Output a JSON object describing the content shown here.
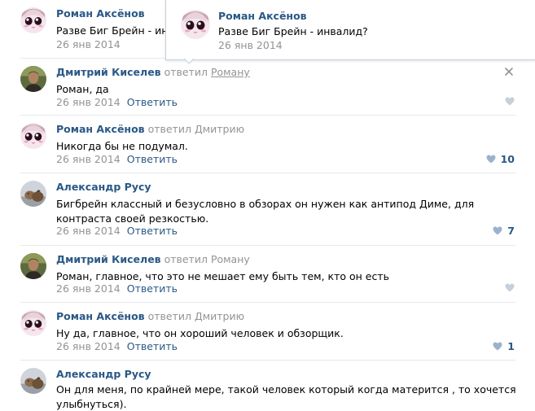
{
  "colors": {
    "author": "#2a5885",
    "muted": "#939393",
    "divider": "#e7e8ec",
    "heart_inactive": "#c5d0db",
    "heart_active": "#9bb2cc"
  },
  "comments": [
    {
      "author": "Роман Аксёнов",
      "reply_word": "",
      "reply_target": "",
      "text": "Разве Биг Брейн - инвалид?",
      "text_visible": "Разве Биг Брейн - инв",
      "date": "26 янв 2014",
      "reply_label": "Ответить",
      "likes": "",
      "avatar": "anime-avatar"
    },
    {
      "author": "Дмитрий Киселев",
      "reply_word": "ответил",
      "reply_target": "Роману",
      "text": "Роман, да",
      "date": "26 янв 2014",
      "reply_label": "Ответить",
      "likes": "",
      "avatar": "photo-avatar-man"
    },
    {
      "author": "Роман Аксёнов",
      "reply_word": "ответил",
      "reply_target": "Дмитрию",
      "text": "Никогда бы не подумал.",
      "date": "26 янв 2014",
      "reply_label": "Ответить",
      "likes": "10",
      "avatar": "anime-avatar"
    },
    {
      "author": "Александр Русу",
      "reply_word": "",
      "reply_target": "",
      "text": "Бигбрейн классный и безусловно в обзорах он нужен как антипод Диме, для контраста своей резкостью.",
      "date": "26 янв 2014",
      "reply_label": "Ответить",
      "likes": "7",
      "avatar": "photo-avatar-dog"
    },
    {
      "author": "Дмитрий Киселев",
      "reply_word": "ответил",
      "reply_target": "Роману",
      "text": "Роман, главное, что это не мешает ему быть тем, кто он есть",
      "date": "26 янв 2014",
      "reply_label": "Ответить",
      "likes": "",
      "avatar": "photo-avatar-man"
    },
    {
      "author": "Роман Аксёнов",
      "reply_word": "ответил",
      "reply_target": "Дмитрию",
      "text": "Ну да, главное, что он хороший человек и обзорщик.",
      "date": "26 янв 2014",
      "reply_label": "Ответить",
      "likes": "1",
      "avatar": "anime-avatar"
    },
    {
      "author": "Александр Русу",
      "reply_word": "",
      "reply_target": "",
      "text": "Он для меня, по крайней мере, такой человек который когда матерится , то хочется улыбнуться).",
      "date": "",
      "reply_label": "",
      "likes": "",
      "avatar": "photo-avatar-dog"
    }
  ],
  "tooltip": {
    "author": "Роман Аксёнов",
    "text": "Разве Биг Брейн - инвалид?",
    "date": "26 янв 2014",
    "avatar": "anime-avatar"
  }
}
